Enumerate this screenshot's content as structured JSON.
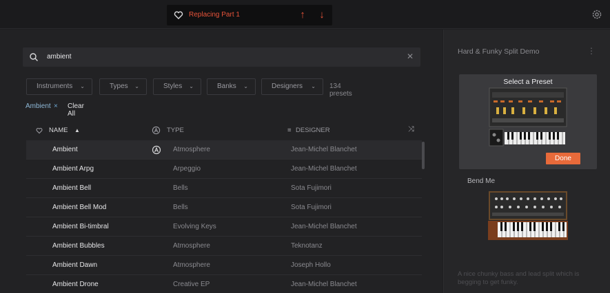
{
  "topbar": {
    "replace_label": "Replacing Part 1",
    "accent": "#e8543a"
  },
  "search": {
    "value": "ambient"
  },
  "filters": {
    "chips": [
      "Instruments",
      "Types",
      "Styles",
      "Banks",
      "Designers"
    ],
    "count": "134 presets"
  },
  "active_tags": {
    "tag": "Ambient",
    "clear_all": "Clear All"
  },
  "table": {
    "headers": {
      "name": "NAME",
      "type": "TYPE",
      "designer": "DESIGNER"
    },
    "rows": [
      {
        "name": "Ambient",
        "type": "Atmosphere",
        "designer": "Jean-Michel Blanchet"
      },
      {
        "name": "Ambient Arpg",
        "type": "Arpeggio",
        "designer": "Jean-Michel Blanchet"
      },
      {
        "name": "Ambient Bell",
        "type": "Bells",
        "designer": "Sota Fujimori"
      },
      {
        "name": "Ambient Bell Mod",
        "type": "Bells",
        "designer": "Sota Fujimori"
      },
      {
        "name": "Ambient Bi-timbral",
        "type": "Evolving Keys",
        "designer": "Jean-Michel Blanchet"
      },
      {
        "name": "Ambient Bubbles",
        "type": "Atmosphere",
        "designer": "Teknotanz"
      },
      {
        "name": "Ambient Dawn",
        "type": "Atmosphere",
        "designer": "Joseph Hollo"
      },
      {
        "name": "Ambient Drone",
        "type": "Creative EP",
        "designer": "Jean-Michel Blanchet"
      }
    ]
  },
  "right_panel": {
    "title": "Hard & Funky Split Demo",
    "card_title": "Select a Preset",
    "done_label": "Done",
    "preset_name": "Bend Me",
    "description": "A nice chunky bass and lead split which is begging to get funky."
  }
}
